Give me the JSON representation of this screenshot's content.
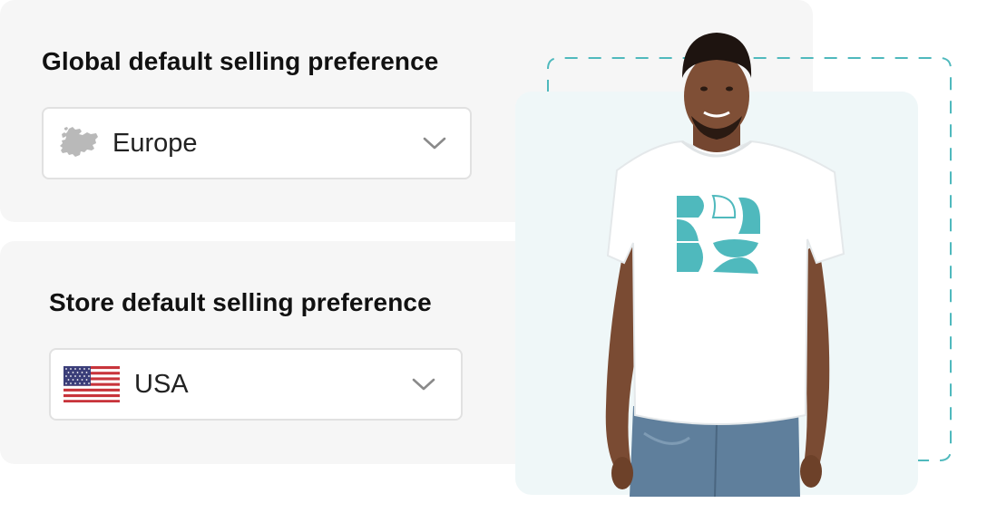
{
  "global_preference": {
    "title": "Global default selling preference",
    "region": {
      "icon": "europe-map-icon",
      "value": "Europe"
    },
    "dropdown_icon": "chevron-down-icon"
  },
  "store_preference": {
    "title": "Store default selling preference",
    "region": {
      "icon": "us-flag-icon",
      "value": "USA"
    },
    "dropdown_icon": "chevron-down-icon"
  },
  "colors": {
    "card_background": "#f6f6f6",
    "select_border": "#e1e1e1",
    "accent_teal": "#4fb9bd",
    "photo_background": "#eff7f8"
  }
}
